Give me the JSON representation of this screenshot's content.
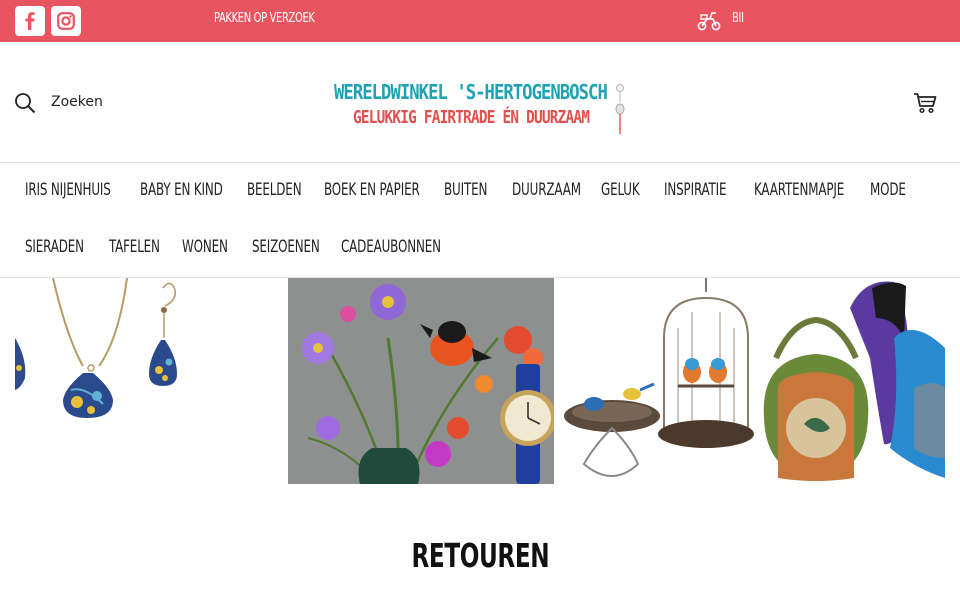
{
  "topbar": {
    "left_text": "PAKKEN OP VERZOEK",
    "right_text": "BII",
    "colors": {
      "background": "#e8545f",
      "text": "#ffffff"
    },
    "icons": [
      "facebook-icon",
      "instagram-icon",
      "scooter-icon"
    ]
  },
  "header": {
    "search_label": "Zoeken",
    "logo_line1": "WERELDWINKEL 'S-HERTOGENBOSCH",
    "logo_line2": "GELUKKIG FAIRTRADE ÉN DUURZAAM",
    "icons": [
      "search-icon",
      "cart-icon"
    ],
    "colors": {
      "logo_line1": "#1fa3b4",
      "logo_line2": "#e0504e"
    }
  },
  "nav": {
    "row1": [
      "IRIS NIJENHUIS",
      "BABY EN KIND",
      "BEELDEN",
      "BOEK EN PAPIER",
      "BUITEN",
      "DUURZAAM",
      "GELUK",
      "INSPIRATIE",
      "KAARTENMAPJE",
      "MODE"
    ],
    "row2": [
      "SIERADEN",
      "TAFELEN",
      "WONEN",
      "SEIZOENEN",
      "CADEAUBONNEN"
    ]
  },
  "page": {
    "title": "RETOUREN"
  }
}
